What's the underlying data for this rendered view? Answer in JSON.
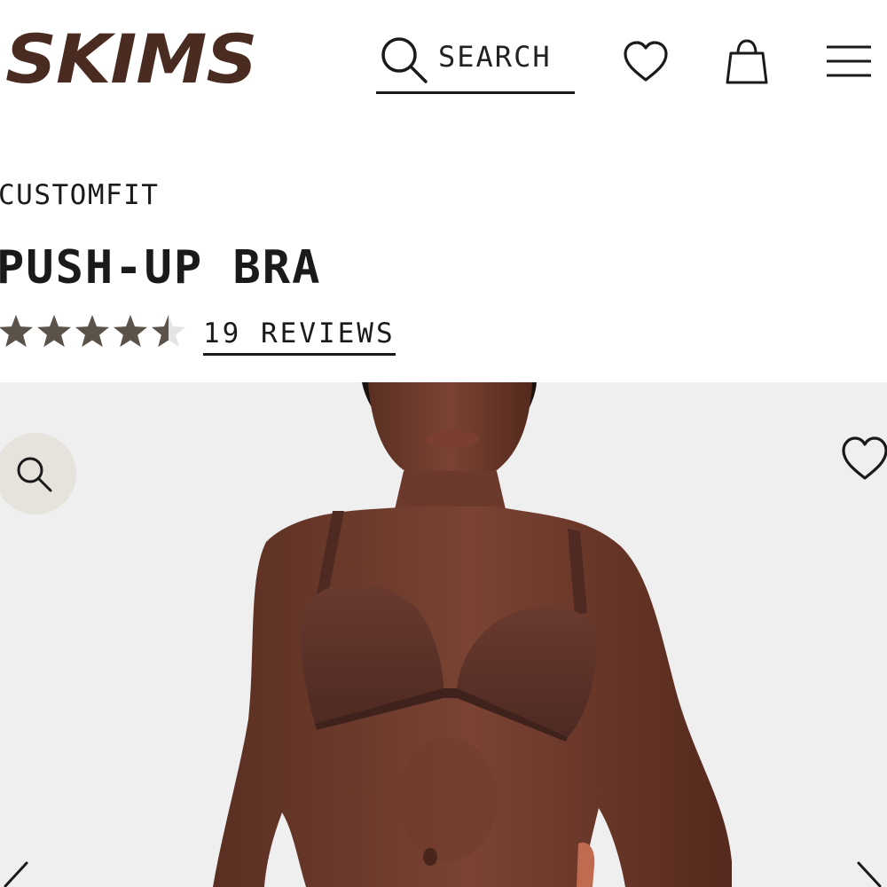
{
  "header": {
    "logo": "SKIMS",
    "search_label": "SEARCH",
    "icons": [
      "search-icon",
      "heart-icon",
      "shopping-bag-icon",
      "menu-icon"
    ]
  },
  "product": {
    "collection": "CUSTOMFIT",
    "title": "PUSH-UP BRA",
    "rating": 4.5,
    "rating_max": 5,
    "reviews_label": "19 REVIEWS"
  },
  "gallery": {
    "icons": [
      "zoom-icon",
      "heart-icon",
      "chevron-left-icon",
      "chevron-right-icon"
    ]
  },
  "colors": {
    "brand": "#4a2b21",
    "star": "#5b5249",
    "gallery_bg": "#efefef",
    "zoom_bg": "#e6e3dd",
    "product_color": "#5a3027"
  }
}
